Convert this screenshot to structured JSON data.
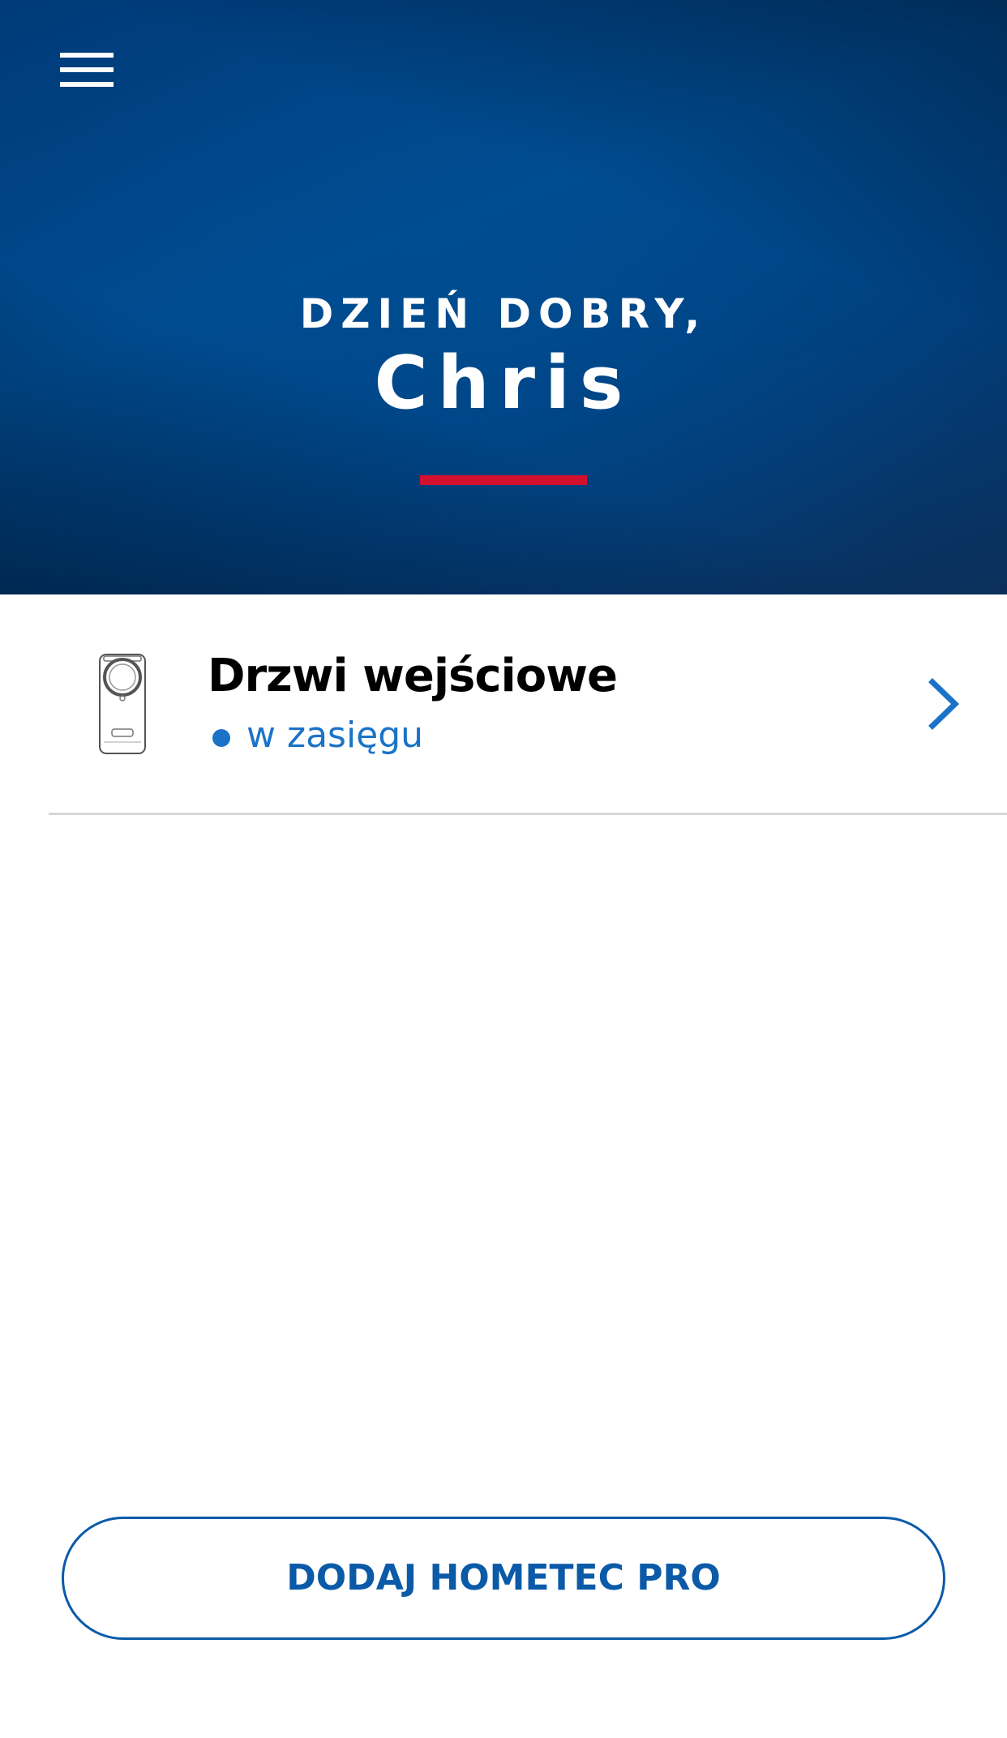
{
  "header": {
    "menu_icon": "hamburger-menu-icon",
    "greeting": "DZIEŃ DOBRY,",
    "username": "Chris",
    "accent_color": "#d3102e",
    "background_color": "#004b8f"
  },
  "devices": [
    {
      "name": "Drzwi wejściowe",
      "status": "w zasięgu",
      "status_color": "#1a73c8",
      "image_icon": "door-lock-device-icon",
      "action_icon": "chevron-right-icon"
    }
  ],
  "actions": {
    "add_button_label": "DODAJ HOMETEC PRO",
    "add_button_color": "#0b5aa8"
  }
}
